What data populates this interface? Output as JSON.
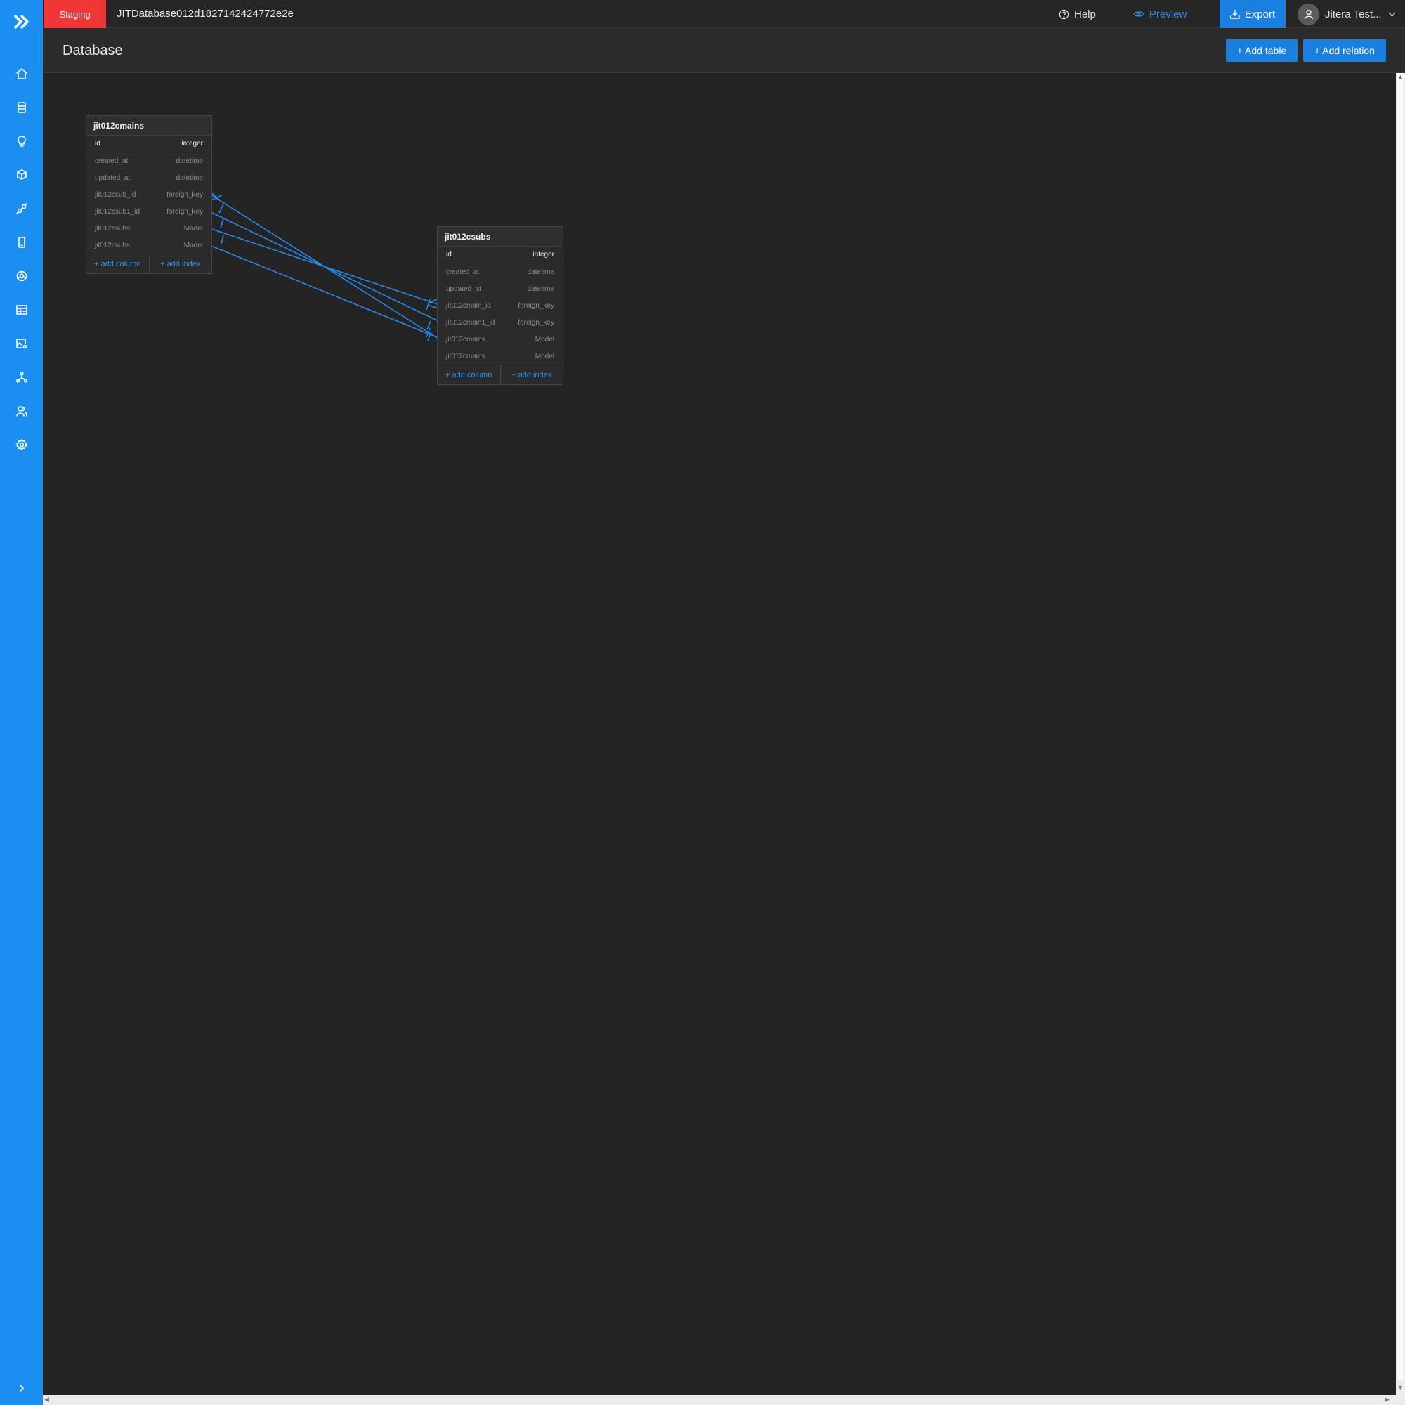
{
  "topbar": {
    "env_badge": "Staging",
    "project_name": "JITDatabase012d1827142424772e2e",
    "help_label": "Help",
    "preview_label": "Preview",
    "export_label": "Export",
    "user_name": "Jitera Test..."
  },
  "header": {
    "title": "Database",
    "add_table_label": "+ Add table",
    "add_relation_label": "+ Add relation"
  },
  "sidebar": {
    "items": [
      {
        "icon": "home-icon"
      },
      {
        "icon": "database-icon"
      },
      {
        "icon": "lightbulb-icon"
      },
      {
        "icon": "cube-icon"
      },
      {
        "icon": "api-icon"
      },
      {
        "icon": "mobile-icon"
      },
      {
        "icon": "web-icon"
      },
      {
        "icon": "table-icon"
      },
      {
        "icon": "image-settings-icon"
      },
      {
        "icon": "network-icon"
      },
      {
        "icon": "users-icon"
      },
      {
        "icon": "gear-icon"
      }
    ]
  },
  "tables": [
    {
      "name": "jit012cmains",
      "columns": [
        {
          "name": "id",
          "type": "integer"
        },
        {
          "name": "created_at",
          "type": "datetime"
        },
        {
          "name": "updated_at",
          "type": "datetime"
        },
        {
          "name": "jit012csub_id",
          "type": "foreign_key"
        },
        {
          "name": "jit012csub1_id",
          "type": "foreign_key"
        },
        {
          "name": "jit012csubs",
          "type": "Model"
        },
        {
          "name": "jit012csubs",
          "type": "Model"
        }
      ],
      "add_column_label": "+ add column",
      "add_index_label": "+ add index"
    },
    {
      "name": "jit012csubs",
      "columns": [
        {
          "name": "id",
          "type": "integer"
        },
        {
          "name": "created_at",
          "type": "datetime"
        },
        {
          "name": "updated_at",
          "type": "datetime"
        },
        {
          "name": "jit012cmain_id",
          "type": "foreign_key"
        },
        {
          "name": "jit012cmain1_id",
          "type": "foreign_key"
        },
        {
          "name": "jit012cmains",
          "type": "Model"
        },
        {
          "name": "jit012cmains",
          "type": "Model"
        }
      ],
      "add_column_label": "+ add column",
      "add_index_label": "+ add index"
    }
  ],
  "colors": {
    "accent": "#1b8ef2",
    "staging": "#ef3737",
    "relation_line": "#2a86e8",
    "canvas_bg": "#242424"
  }
}
